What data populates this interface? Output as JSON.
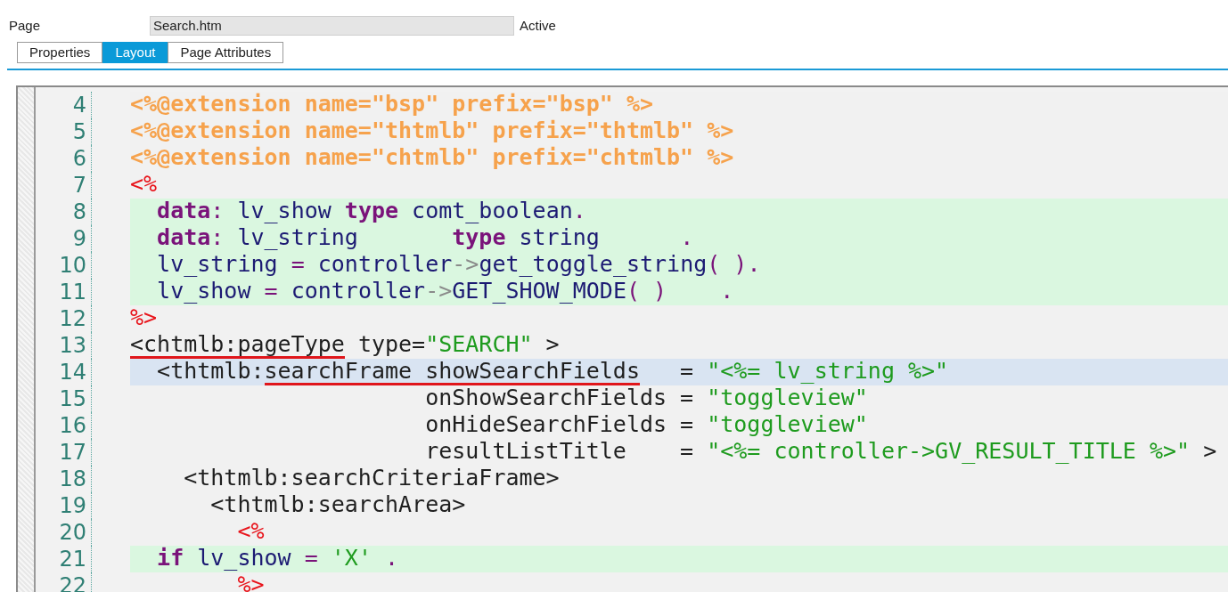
{
  "header": {
    "label": "Page",
    "value": "Search.htm",
    "status": "Active"
  },
  "tabs": [
    {
      "label": "Properties",
      "selected": false
    },
    {
      "label": "Layout",
      "selected": true
    },
    {
      "label": "Page Attributes",
      "selected": false
    }
  ],
  "editor": {
    "lines": [
      {
        "number": "4",
        "script_block": false,
        "current": false,
        "segments": [
          {
            "kind": "directive",
            "text": "<%@extension name=\"bsp\" prefix=\"bsp\" %>",
            "underlined": false
          }
        ]
      },
      {
        "number": "5",
        "script_block": false,
        "current": false,
        "segments": [
          {
            "kind": "directive",
            "text": "<%@extension name=\"thtmlb\" prefix=\"thtmlb\" %>",
            "underlined": false
          }
        ]
      },
      {
        "number": "6",
        "script_block": false,
        "current": false,
        "segments": [
          {
            "kind": "directive",
            "text": "<%@extension name=\"chtmlb\" prefix=\"chtmlb\" %>",
            "underlined": false
          }
        ]
      },
      {
        "number": "7",
        "script_block": false,
        "current": false,
        "segments": [
          {
            "kind": "delimiter",
            "text": "<%",
            "underlined": false
          }
        ]
      },
      {
        "number": "8",
        "script_block": true,
        "current": false,
        "segments": [
          {
            "kind": "keyword",
            "text": "  data",
            "underlined": false
          },
          {
            "kind": "operator",
            "text": ":",
            "underlined": false
          },
          {
            "kind": "identifier",
            "text": " lv_show ",
            "underlined": false
          },
          {
            "kind": "keyword",
            "text": "type",
            "underlined": false
          },
          {
            "kind": "identifier",
            "text": " comt_boolean",
            "underlined": false
          },
          {
            "kind": "operator",
            "text": ".",
            "underlined": false
          }
        ]
      },
      {
        "number": "9",
        "script_block": true,
        "current": false,
        "segments": [
          {
            "kind": "keyword",
            "text": "  data",
            "underlined": false
          },
          {
            "kind": "operator",
            "text": ":",
            "underlined": false
          },
          {
            "kind": "identifier",
            "text": " lv_string       ",
            "underlined": false
          },
          {
            "kind": "keyword",
            "text": "type",
            "underlined": false
          },
          {
            "kind": "identifier",
            "text": " string      ",
            "underlined": false
          },
          {
            "kind": "operator",
            "text": ".",
            "underlined": false
          }
        ]
      },
      {
        "number": "10",
        "script_block": true,
        "current": false,
        "segments": [
          {
            "kind": "identifier",
            "text": "  lv_string ",
            "underlined": false
          },
          {
            "kind": "operator",
            "text": "=",
            "underlined": false
          },
          {
            "kind": "identifier",
            "text": " controller",
            "underlined": false
          },
          {
            "kind": "arrow",
            "text": "->",
            "underlined": false
          },
          {
            "kind": "identifier",
            "text": "get_toggle_string",
            "underlined": false
          },
          {
            "kind": "operator",
            "text": "( ).",
            "underlined": false
          }
        ]
      },
      {
        "number": "11",
        "script_block": true,
        "current": false,
        "segments": [
          {
            "kind": "identifier",
            "text": "  lv_show ",
            "underlined": false
          },
          {
            "kind": "operator",
            "text": "=",
            "underlined": false
          },
          {
            "kind": "identifier",
            "text": " controller",
            "underlined": false
          },
          {
            "kind": "arrow",
            "text": "->",
            "underlined": false
          },
          {
            "kind": "identifier",
            "text": "GET_SHOW_MODE",
            "underlined": false
          },
          {
            "kind": "operator",
            "text": "( )    .",
            "underlined": false
          }
        ]
      },
      {
        "number": "12",
        "script_block": false,
        "current": false,
        "segments": [
          {
            "kind": "delimiter",
            "text": "%>",
            "underlined": false
          }
        ]
      },
      {
        "number": "13",
        "script_block": false,
        "current": false,
        "segments": [
          {
            "kind": "tag",
            "text": "<chtmlb:pageType",
            "underlined": true
          },
          {
            "kind": "tag",
            "text": " type=",
            "underlined": false
          },
          {
            "kind": "string",
            "text": "\"SEARCH\"",
            "underlined": false
          },
          {
            "kind": "tag",
            "text": " >",
            "underlined": false
          }
        ]
      },
      {
        "number": "14",
        "script_block": false,
        "current": true,
        "segments": [
          {
            "kind": "tag",
            "text": "  <thtmlb:",
            "underlined": false
          },
          {
            "kind": "tag",
            "text": "searchFrame showSearchFields",
            "underlined": true
          },
          {
            "kind": "tag",
            "text": "   = ",
            "underlined": false
          },
          {
            "kind": "string",
            "text": "\"<%= lv_string %>\"",
            "underlined": false
          }
        ]
      },
      {
        "number": "15",
        "script_block": false,
        "current": false,
        "segments": [
          {
            "kind": "tag",
            "text": "                      onShowSearchFields = ",
            "underlined": false
          },
          {
            "kind": "string",
            "text": "\"toggleview\"",
            "underlined": false
          }
        ]
      },
      {
        "number": "16",
        "script_block": false,
        "current": false,
        "segments": [
          {
            "kind": "tag",
            "text": "                      onHideSearchFields = ",
            "underlined": false
          },
          {
            "kind": "string",
            "text": "\"toggleview\"",
            "underlined": false
          }
        ]
      },
      {
        "number": "17",
        "script_block": false,
        "current": false,
        "segments": [
          {
            "kind": "tag",
            "text": "                      resultListTitle    = ",
            "underlined": false
          },
          {
            "kind": "string",
            "text": "\"<%= controller->GV_RESULT_TITLE %>\"",
            "underlined": false
          },
          {
            "kind": "tag",
            "text": " >",
            "underlined": false
          }
        ]
      },
      {
        "number": "18",
        "script_block": false,
        "current": false,
        "segments": [
          {
            "kind": "tag",
            "text": "    <thtmlb:searchCriteriaFrame>",
            "underlined": false
          }
        ]
      },
      {
        "number": "19",
        "script_block": false,
        "current": false,
        "segments": [
          {
            "kind": "tag",
            "text": "      <thtmlb:searchArea>",
            "underlined": false
          }
        ]
      },
      {
        "number": "20",
        "script_block": false,
        "current": false,
        "segments": [
          {
            "kind": "delimiter",
            "text": "        <%",
            "underlined": false
          }
        ]
      },
      {
        "number": "21",
        "script_block": true,
        "current": false,
        "segments": [
          {
            "kind": "keyword",
            "text": "  if",
            "underlined": false
          },
          {
            "kind": "identifier",
            "text": " lv_show ",
            "underlined": false
          },
          {
            "kind": "operator",
            "text": "=",
            "underlined": false
          },
          {
            "kind": "string",
            "text": " 'X' ",
            "underlined": false
          },
          {
            "kind": "operator",
            "text": ".",
            "underlined": false
          }
        ]
      },
      {
        "number": "22",
        "script_block": false,
        "current": false,
        "segments": [
          {
            "kind": "delimiter",
            "text": "        %>"
          }
        ]
      }
    ]
  }
}
